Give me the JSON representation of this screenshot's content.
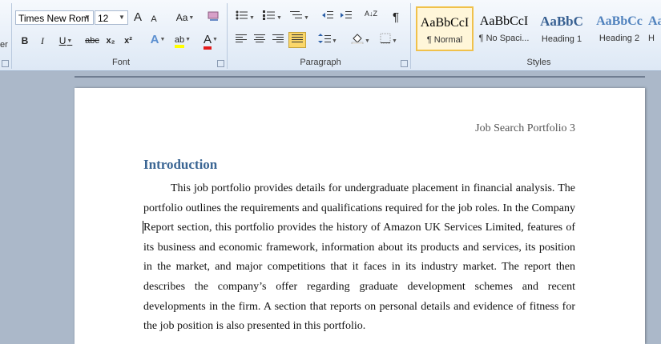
{
  "ribbon": {
    "font_group_label": "Font",
    "paragraph_group_label": "Paragraph",
    "styles_group_label": "Styles",
    "side_label": "er",
    "font_name": "Times New Rom",
    "font_size": "12",
    "grow_font_label": "A",
    "shrink_font_label": "A",
    "change_case_label": "Aa",
    "bold_label": "B",
    "italic_label": "I",
    "underline_label": "U",
    "strike_label": "abc",
    "subscript_label": "x₂",
    "superscript_label": "x²",
    "text_effects_label": "A",
    "highlight_label": "ab",
    "font_color_label": "A",
    "sort_label": "A↓Z",
    "pilcrow_label": "¶",
    "styles": [
      {
        "sample": "AaBbCcI",
        "name": "¶ Normal",
        "color": "#000000"
      },
      {
        "sample": "AaBbCcI",
        "name": "¶ No Spaci...",
        "color": "#000000"
      },
      {
        "sample": "AaBbC",
        "name": "Heading 1",
        "color": "#365f91"
      },
      {
        "sample": "AaBbCc",
        "name": "Heading 2",
        "color": "#4f81bd"
      },
      {
        "sample": "Aa",
        "name": "H",
        "color": "#4f81bd"
      }
    ]
  },
  "document": {
    "header": "Job Search Portfolio 3",
    "heading": "Introduction",
    "paragraph": "This job portfolio provides details for undergraduate placement in financial analysis. The portfolio outlines the requirements and qualifications required for the job roles. In the Company Report section, this portfolio provides the history of Amazon UK Services Limited, features of its business and economic framework, information about its products and services, its position in the market, and major competitions that it faces in its industry market. The report then describes the company’s offer regarding graduate development schemes and recent developments in the firm. A section that reports on personal details and evidence of fitness for the job position is also presented in this portfolio."
  }
}
